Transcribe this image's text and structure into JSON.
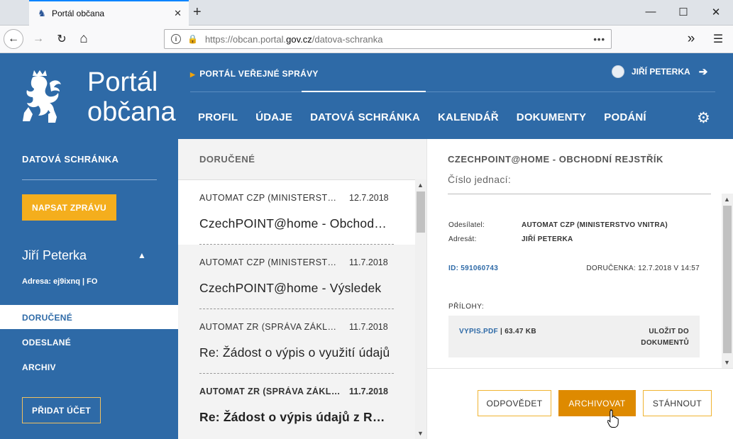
{
  "browser": {
    "tab_title": "Portál občana",
    "tab_close": "✕",
    "new_tab": "+",
    "url_prefix": "https://obcan.portal.",
    "url_domain": "gov.cz",
    "url_path": "/datova-schranka",
    "url_dots": "•••",
    "win_min": "—",
    "win_max": "☐",
    "win_close": "✕",
    "nav_back": "←",
    "nav_forward": "→",
    "nav_reload": "↻",
    "nav_home": "⌂",
    "overflow": "»",
    "menu": "☰"
  },
  "header": {
    "brand_line1": "Portál",
    "brand_line2": "občana",
    "pvs_label": "PORTÁL VEŘEJNÉ SPRÁVY",
    "user_name": "JIŘÍ PETERKA",
    "nav": [
      "PROFIL",
      "ÚDAJE",
      "DATOVÁ SCHRÁNKA",
      "KALENDÁŘ",
      "DOKUMENTY",
      "PODÁNÍ"
    ]
  },
  "sidebar": {
    "title": "DATOVÁ SCHRÁNKA",
    "write_button": "NAPSAT ZPRÁVU",
    "name": "Jiří Peterka",
    "address": "Adresa: ej9ixnq | FO",
    "items": [
      "DORUČENÉ",
      "ODESLANÉ",
      "ARCHIV"
    ],
    "active_item": "DORUČENÉ",
    "add_button": "PŘIDAT ÚČET"
  },
  "list": {
    "title": "DORUČENÉ",
    "messages": [
      {
        "sender": "AUTOMAT CZP (MINISTERSTVO VNITRA)",
        "date": "12.7.2018",
        "subject": "CzechPOINT@home - Obchodní rejstřík",
        "active": true,
        "unread": false
      },
      {
        "sender": "AUTOMAT CZP (MINISTERSTVO VNITRA)",
        "date": "11.7.2018",
        "subject": "CzechPOINT@home - Výsledek",
        "active": false,
        "unread": false
      },
      {
        "sender": "AUTOMAT ZR (SPRÁVA ZÁKLADNÍCH REGISTRŮ)",
        "date": "11.7.2018",
        "subject": "Re: Žádost o výpis o využití údajů",
        "active": false,
        "unread": false
      },
      {
        "sender": "AUTOMAT ZR (SPRÁVA ZÁKLADNÍCH REGISTRŮ)",
        "date": "11.7.2018",
        "subject": "Re: Žádost o výpis údajů z ROB",
        "active": false,
        "unread": true
      }
    ]
  },
  "detail": {
    "title": "CZECHPOINT@HOME - OBCHODNÍ REJSTŘÍK",
    "case_number_label": "Číslo jednací:",
    "sender_label": "Odesílatel:",
    "sender_value": "AUTOMAT CZP (MINISTERSTVO VNITRA)",
    "recipient_label": "Adresát:",
    "recipient_value": "JIŘÍ PETERKA",
    "id": "ID: 591060743",
    "delivery": "DORUČENKA: 12.7.2018 V 14:57",
    "attachments_label": "PŘÍLOHY:",
    "attachment_name": "VYPIS.PDF",
    "attachment_size": " | 63.47 KB",
    "attachment_save": "ULOŽIT DO DOKUMENTŮ",
    "buttons": {
      "reply": "ODPOVĚDET",
      "archive": "ARCHIVOVAT",
      "download": "STÁHNOUT"
    }
  },
  "colors": {
    "primary": "#2e6aa7",
    "accent": "#f4ae1d",
    "archive": "#de8a00"
  }
}
